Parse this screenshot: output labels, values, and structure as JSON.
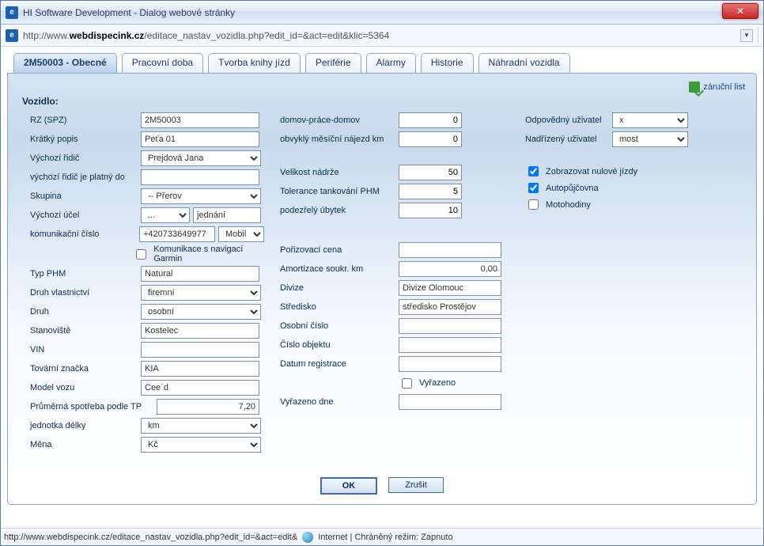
{
  "window": {
    "title": "HI Software Development - Dialog webové stránky"
  },
  "url_prefix": "http://www.",
  "url_bold": "webdispecink.cz",
  "url_rest": "/editace_nastav_vozidla.php?edit_id=&act=edit&klic=5364",
  "tabs": [
    "2M50003 - Obecné",
    "Pracovní doba",
    "Tvorba knihy jízd",
    "Periférie",
    "Alarmy",
    "Historie",
    "Náhradní vozidla"
  ],
  "warranty": "záruční list",
  "section_title": "Vozidlo:",
  "buttons": {
    "ok": "OK",
    "cancel": "Zrušit"
  },
  "col1": {
    "rz_label": "RZ (SPZ)",
    "rz": "2M50003",
    "popis_label": "Krátký popis",
    "popis": "Peťa 01",
    "ridic_label": "Výchozí řidič",
    "ridic": "Prejdová Jana",
    "ridic_platny_label": "výchozí řidič je platný do",
    "ridic_platny": "",
    "skupina_label": "Skupina",
    "skupina": "-- Přerov",
    "ucel_label": "Výchozí účel",
    "ucel_sel": "...",
    "ucel_text": "jednání",
    "komcislo_label": "komunikační číslo",
    "komcislo": "+420733649977",
    "komcislo_sel": "Mobil",
    "garmin_label": "Komunikace s navigací Garmin",
    "typphm_label": "Typ PHM",
    "typphm": "Natural",
    "vlast_label": "Druh vlastnictví",
    "vlast": "firemní",
    "druh_label": "Druh",
    "druh": "osobní",
    "stan_label": "Stanoviště",
    "stan": "Kostelec",
    "vin_label": "VIN",
    "vin": "",
    "znacka_label": "Tovární značka",
    "znacka": "KIA",
    "model_label": "Model vozu",
    "model": "Cee´d",
    "spotreba_label": "Průměrná spotřeba podle TP",
    "spotreba": "7,20",
    "delka_label": "jednotka délky",
    "delka": "km",
    "mena_label": "Měna",
    "mena": "Kč"
  },
  "col2": {
    "dpd_label": "domov-práce-domov",
    "dpd": "0",
    "najezd_label": "obvyklý měsíční nájezd km",
    "najezd": "0",
    "nadrz_label": "Velikost nádrže",
    "nadrz": "50",
    "toler_label": "Tolerance tankování PHM",
    "toler": "5",
    "ubytek_label": "podezřelý úbytek",
    "ubytek": "10",
    "poriz_label": "Pořizovací cena",
    "poriz": "",
    "amort_label": "Amortizace soukr. km",
    "amort": "0,00",
    "divize_label": "Divize",
    "divize": "Divize Olomouc",
    "stred_label": "Středisko",
    "stred": "středisko Prostějov",
    "oscislo_label": "Osobní číslo",
    "oscislo": "",
    "objekt_label": "Číslo objektu",
    "objekt": "",
    "datreg_label": "Datum registrace",
    "datreg": "",
    "vyrazeno_label": "Vyřazeno",
    "vyrazdne_label": "Vyřazeno dne",
    "vyrazdne": ""
  },
  "col3": {
    "odpov_label": "Odpovědný uživatel",
    "odpov": "x",
    "nadriz_label": "Nadřízený uživatel",
    "nadriz": "most",
    "nulove": "Zobrazovat nulové jízdy",
    "autop": "Autopůjčovna",
    "moto": "Motohodiny"
  },
  "status": {
    "left": "http://www.webdispecink.cz/editace_nastav_vozidla.php?edit_id=&act=edit&",
    "right": "Internet | Chráněný režim: Zapnuto"
  }
}
